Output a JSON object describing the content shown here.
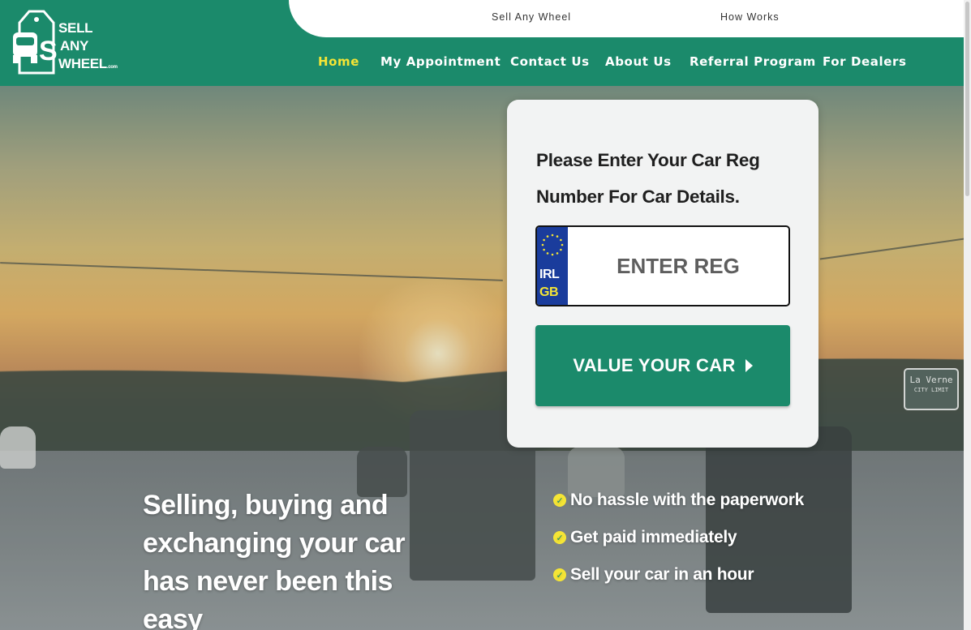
{
  "top_links": [
    "Sell Any Wheel",
    "How Works"
  ],
  "logo": {
    "line1": "SELL",
    "line2": "ANY",
    "line3": "WHEEL",
    "suffix": ".com",
    "icon": "car-tag-logo-icon"
  },
  "nav": {
    "items": [
      {
        "label": "Home",
        "active": true
      },
      {
        "label": "My Appointment",
        "active": false
      },
      {
        "label": "Contact Us",
        "active": false
      },
      {
        "label": "About Us",
        "active": false
      },
      {
        "label": "Referral Program",
        "active": false
      },
      {
        "label": "For Dealers",
        "active": false
      }
    ]
  },
  "form": {
    "title": "Please Enter Your Car Reg Number For Car Details.",
    "plate_code_top": "IRL",
    "plate_code_bottom": "GB",
    "reg_placeholder": "ENTER REG",
    "reg_value": "",
    "button_label": "VALUE YOUR CAR"
  },
  "hero": {
    "tagline": "Selling, buying and exchanging your car has never been this easy",
    "benefits": [
      "No hassle with the paperwork",
      "Get paid immediately",
      "Sell your car in an hour"
    ],
    "sign_title": "La Verne",
    "sign_subtitle": "CITY LIMIT"
  },
  "colors": {
    "brand": "#1b8a6b",
    "accent": "#f5e535",
    "card": "#f2f3f3"
  }
}
